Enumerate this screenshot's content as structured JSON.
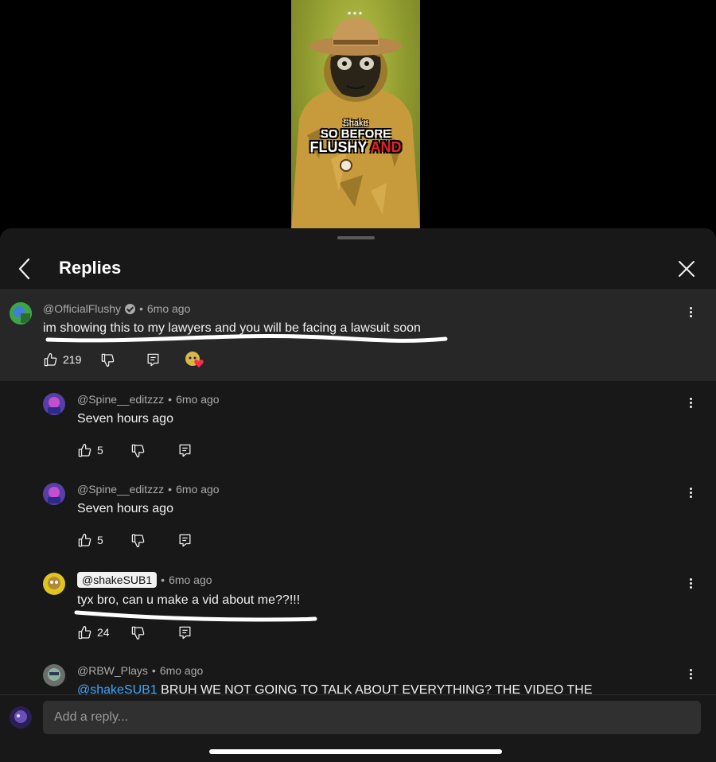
{
  "video": {
    "menu_dots": "•••",
    "caption_small": "Shake",
    "caption_line1": "SO BEFORE",
    "caption_line2": "FLUSHY",
    "caption_line2_accent": "AND"
  },
  "header": {
    "title": "Replies"
  },
  "comments": [
    {
      "author": "@OfficialFlushy",
      "time": "6mo ago",
      "text": "im showing this to my lawyers and you will be facing a lawsuit soon",
      "likes": "219",
      "verified": true
    },
    {
      "author": "@Spine__editzzz",
      "time": "6mo ago",
      "text": "Seven hours ago",
      "likes": "5"
    },
    {
      "author": "@Spine__editzzz",
      "time": "6mo ago",
      "text": "Seven hours ago",
      "likes": "5"
    },
    {
      "author": "@shakeSUB1",
      "time": "6mo ago",
      "text": "tyx bro, can u make a vid about me??!!!",
      "likes": "24"
    },
    {
      "author": "@RBW_Plays",
      "time": "6mo ago",
      "mention": "@shakeSUB1",
      "text": " BRUH WE NOT GOING TO TALK ABOUT EVERYTHING? THE VIDEO THE"
    }
  ],
  "reply_box": {
    "placeholder": "Add a reply..."
  },
  "colors": {
    "sheet_bg": "#181818",
    "highlight_bg": "#272727",
    "link": "#3ea6ff",
    "heart": "#ff2b4a"
  }
}
